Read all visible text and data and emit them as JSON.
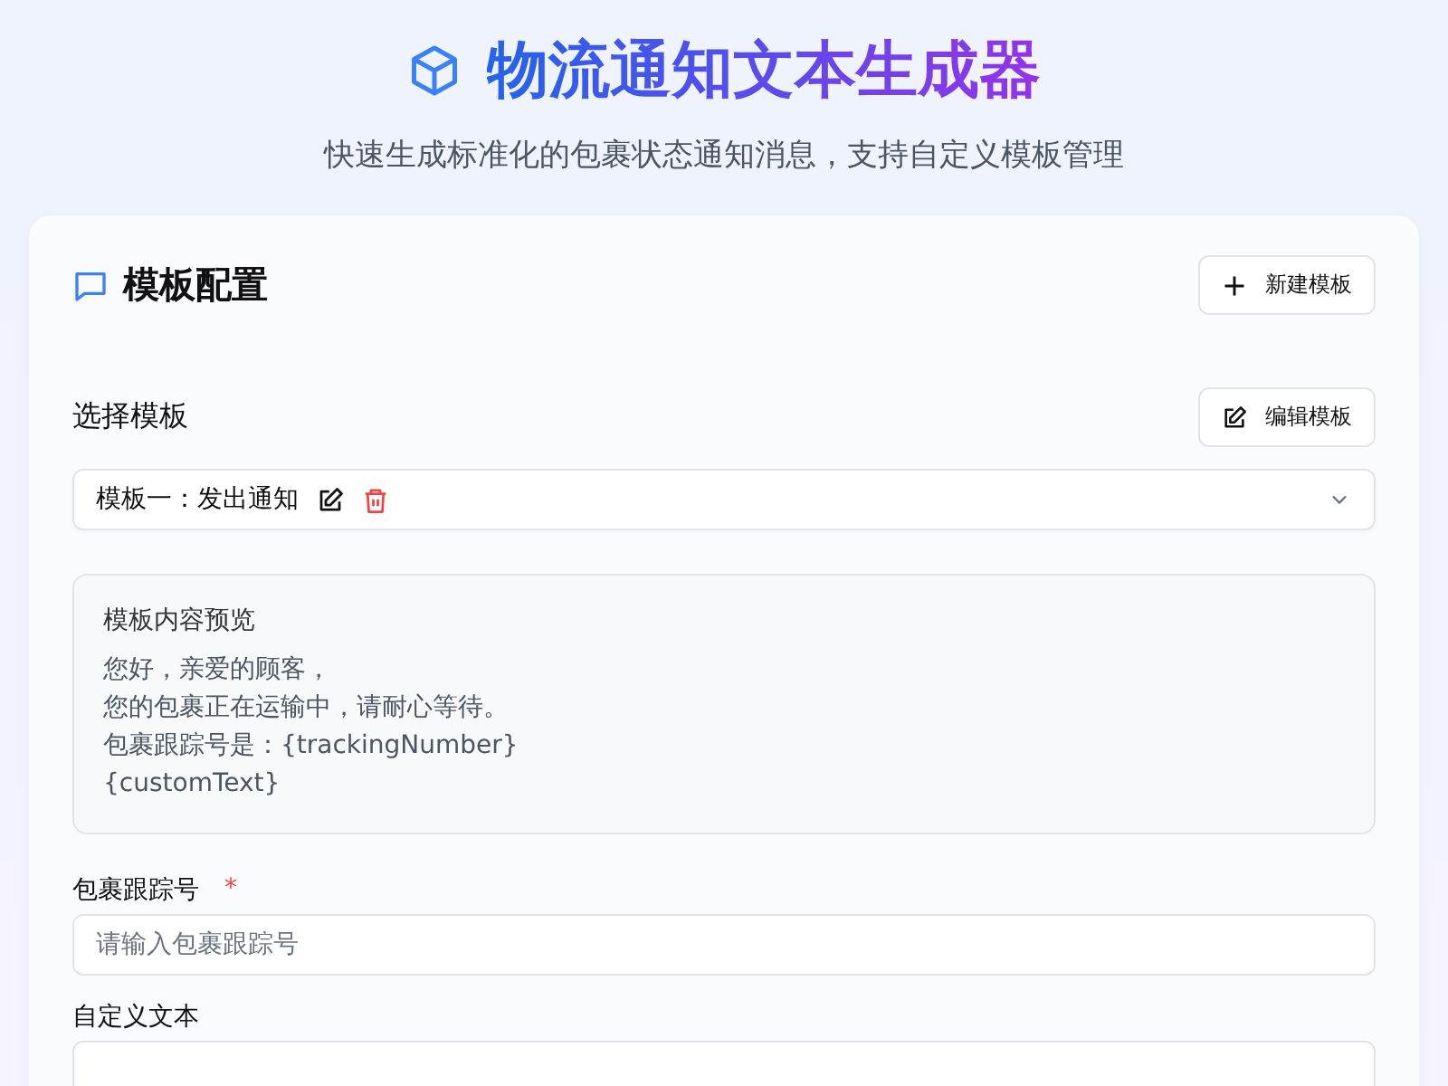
{
  "header": {
    "title": "物流通知文本生成器",
    "subtitle": "快速生成标准化的包裹状态通知消息，支持自定义模板管理"
  },
  "card": {
    "title": "模板配置",
    "new_button": "新建模板",
    "select_label": "选择模板",
    "edit_button": "编辑模板",
    "template_select": {
      "value": "模板一：发出通知"
    },
    "preview": {
      "title": "模板内容预览",
      "lines": [
        "您好，亲爱的顾客，",
        "您的包裹正在运输中，请耐心等待。",
        "包裹跟踪号是：{trackingNumber}",
        "{customText}"
      ]
    },
    "fields": [
      {
        "label": "包裹跟踪号",
        "required_mark": "*",
        "placeholder": "请输入包裹跟踪号",
        "kind": "input"
      },
      {
        "label": "自定义文本",
        "kind": "textarea"
      }
    ]
  }
}
